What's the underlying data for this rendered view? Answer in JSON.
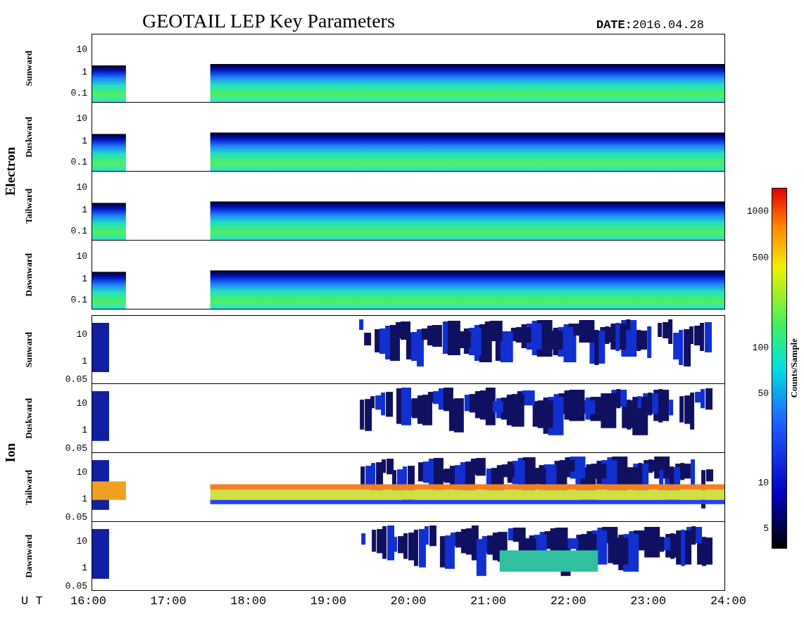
{
  "title": "GEOTAIL LEP Key Parameters",
  "date": {
    "label": "DATE:",
    "value": "2016.04.28"
  },
  "groups": [
    {
      "label": "Electron",
      "kind": "electron",
      "panels": [
        {
          "label": "Sunward",
          "yticks": [
            "10",
            "1",
            "0.1"
          ]
        },
        {
          "label": "Duskward",
          "yticks": [
            "10",
            "1",
            "0.1"
          ]
        },
        {
          "label": "Tailward",
          "yticks": [
            "10",
            "1",
            "0.1"
          ]
        },
        {
          "label": "Dawnward",
          "yticks": [
            "10",
            "1",
            "0.1"
          ]
        }
      ]
    },
    {
      "label": "Ion",
      "kind": "ion",
      "panels": [
        {
          "label": "Sunward",
          "yticks": [
            "10",
            "1",
            "0.05"
          ]
        },
        {
          "label": "Duskward",
          "yticks": [
            "10",
            "1",
            "0.05"
          ]
        },
        {
          "label": "Tailward",
          "yticks": [
            "10",
            "1",
            "0.05"
          ]
        },
        {
          "label": "Dawnward",
          "yticks": [
            "10",
            "1",
            "0.05"
          ]
        }
      ]
    }
  ],
  "x_axis": {
    "label": "U T",
    "ticks": [
      "16:00",
      "17:00",
      "18:00",
      "19:00",
      "20:00",
      "21:00",
      "22:00",
      "23:00",
      "24:00"
    ]
  },
  "color_scale": {
    "label": "Counts/Sample",
    "ticks": [
      "1000",
      "500",
      "100",
      "50",
      "10",
      "5"
    ]
  }
}
